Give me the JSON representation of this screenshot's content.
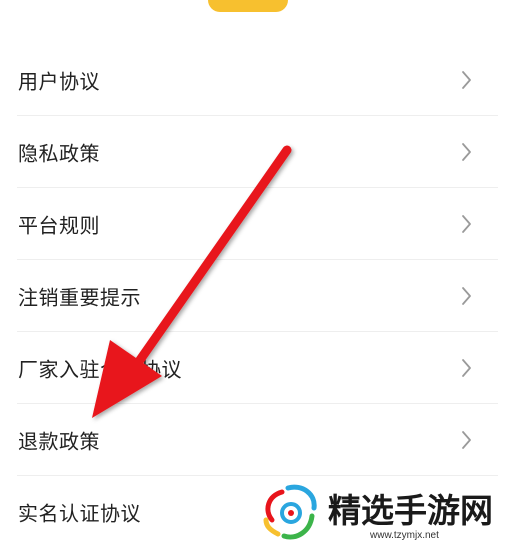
{
  "menu": {
    "items": [
      {
        "label": "用户协议"
      },
      {
        "label": "隐私政策"
      },
      {
        "label": "平台规则"
      },
      {
        "label": "注销重要提示"
      },
      {
        "label": "厂家入驻合作协议"
      },
      {
        "label": "退款政策"
      },
      {
        "label": "实名认证协议"
      }
    ]
  },
  "icons": {
    "chevron": "chevron-right-icon",
    "arrow": "red-arrow-annotation-icon",
    "watermark_logo": "site-logo-icon"
  },
  "colors": {
    "top_button": "#f7c02f",
    "arrow": "#e8141b",
    "chevron": "#9a9a9a",
    "divider": "#eeeeee"
  },
  "watermark": {
    "name": "精选手游网",
    "url": "www.tzymjx.net"
  }
}
